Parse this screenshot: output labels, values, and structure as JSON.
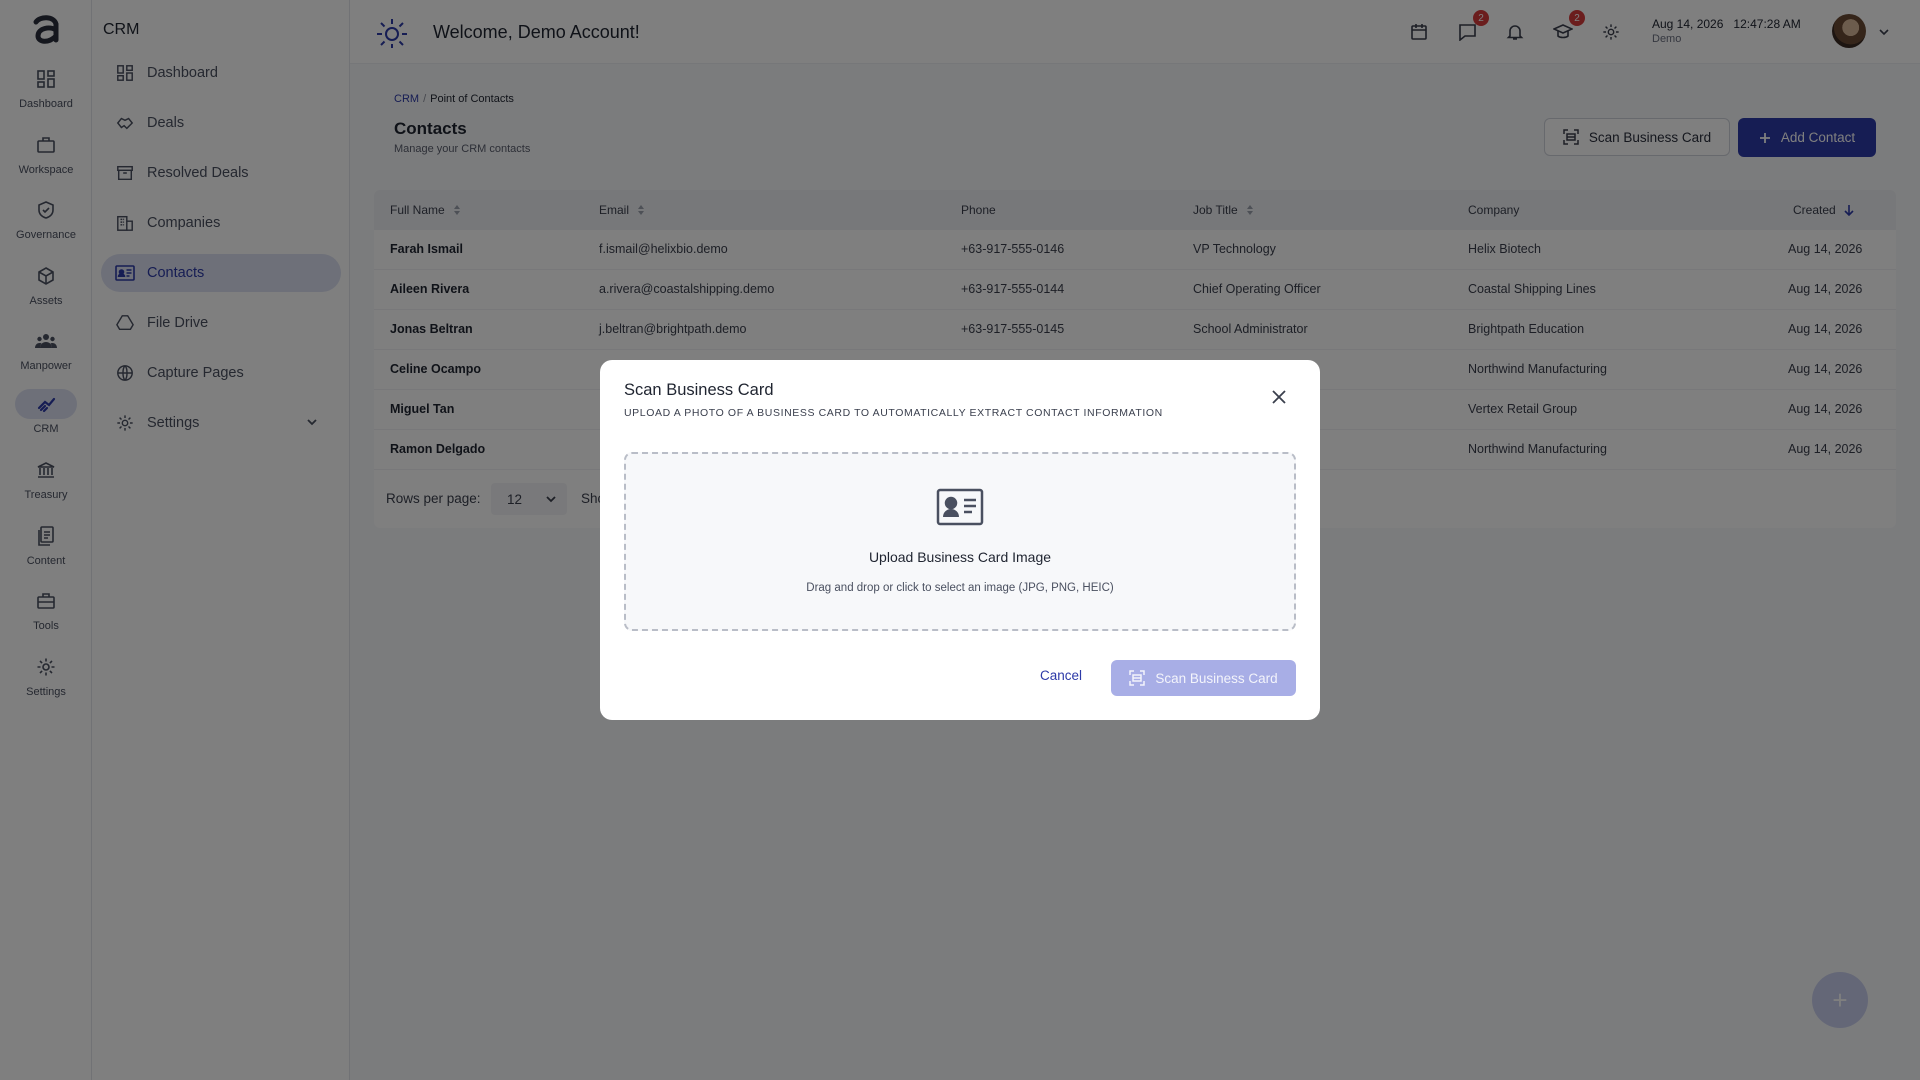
{
  "rail": {
    "items": [
      {
        "label": "Dashboard",
        "icon": "dashboard-icon"
      },
      {
        "label": "Workspace",
        "icon": "briefcase-icon"
      },
      {
        "label": "Governance",
        "icon": "shield-icon"
      },
      {
        "label": "Assets",
        "icon": "cube-icon"
      },
      {
        "label": "Manpower",
        "icon": "people-icon"
      },
      {
        "label": "CRM",
        "icon": "handshake-icon"
      },
      {
        "label": "Treasury",
        "icon": "bank-icon"
      },
      {
        "label": "Content",
        "icon": "document-icon"
      },
      {
        "label": "Tools",
        "icon": "toolbox-icon"
      },
      {
        "label": "Settings",
        "icon": "gear-icon"
      }
    ],
    "active": "CRM"
  },
  "sidebar": {
    "title": "CRM",
    "items": [
      {
        "label": "Dashboard",
        "icon": "dashboard-icon"
      },
      {
        "label": "Deals",
        "icon": "handshake-icon"
      },
      {
        "label": "Resolved Deals",
        "icon": "archive-icon"
      },
      {
        "label": "Companies",
        "icon": "building-icon"
      },
      {
        "label": "Contacts",
        "icon": "contact-card-icon"
      },
      {
        "label": "File Drive",
        "icon": "drive-icon"
      },
      {
        "label": "Capture Pages",
        "icon": "globe-icon"
      },
      {
        "label": "Settings",
        "icon": "gear-icon"
      }
    ],
    "active": "Contacts"
  },
  "header": {
    "welcome": "Welcome, Demo Account!",
    "messages_badge": "2",
    "learning_badge": "2",
    "date": "Aug 14, 2026",
    "time": "12:47:28 AM",
    "account": "Demo"
  },
  "breadcrumb": {
    "root": "CRM",
    "separator": "/",
    "current": "Point of Contacts"
  },
  "page": {
    "title": "Contacts",
    "subtitle": "Manage your CRM contacts",
    "scan_button": "Scan Business Card",
    "add_button": "Add Contact"
  },
  "table": {
    "columns": [
      "Full Name",
      "Email",
      "Phone",
      "Job Title",
      "Company",
      "Created"
    ],
    "rows": [
      [
        "Farah Ismail",
        "f.ismail@helixbio.demo",
        "+63-917-555-0146",
        "VP Technology",
        "Helix Biotech",
        "Aug 14, 2026"
      ],
      [
        "Aileen Rivera",
        "a.rivera@coastalshipping.demo",
        "+63-917-555-0144",
        "Chief Operating Officer",
        "Coastal Shipping Lines",
        "Aug 14, 2026"
      ],
      [
        "Jonas Beltran",
        "j.beltran@brightpath.demo",
        "+63-917-555-0145",
        "School Administrator",
        "Brightpath Education",
        "Aug 14, 2026"
      ],
      [
        "Celine Ocampo",
        "",
        "",
        "",
        "Northwind Manufacturing",
        "Aug 14, 2026"
      ],
      [
        "Miguel Tan",
        "",
        "",
        "",
        "Vertex Retail Group",
        "Aug 14, 2026"
      ],
      [
        "Ramon Delgado",
        "",
        "",
        "",
        "Northwind Manufacturing",
        "Aug 14, 2026"
      ]
    ],
    "rows_per_page_label": "Rows per page:",
    "rows_per_page": "12",
    "showing_partial": "Sho"
  },
  "modal": {
    "title": "Scan Business Card",
    "subtitle": "UPLOAD A PHOTO OF A BUSINESS CARD TO AUTOMATICALLY EXTRACT CONTACT INFORMATION",
    "drop_title": "Upload Business Card Image",
    "drop_hint": "Drag and drop or click to select an image (JPG, PNG, HEIC)",
    "cancel": "Cancel",
    "submit": "Scan Business Card"
  },
  "colors": {
    "primary": "#2d3aa8",
    "active_bg": "#dde1f2",
    "disabled_primary": "#a8aee6",
    "badge": "#d63b3b"
  }
}
